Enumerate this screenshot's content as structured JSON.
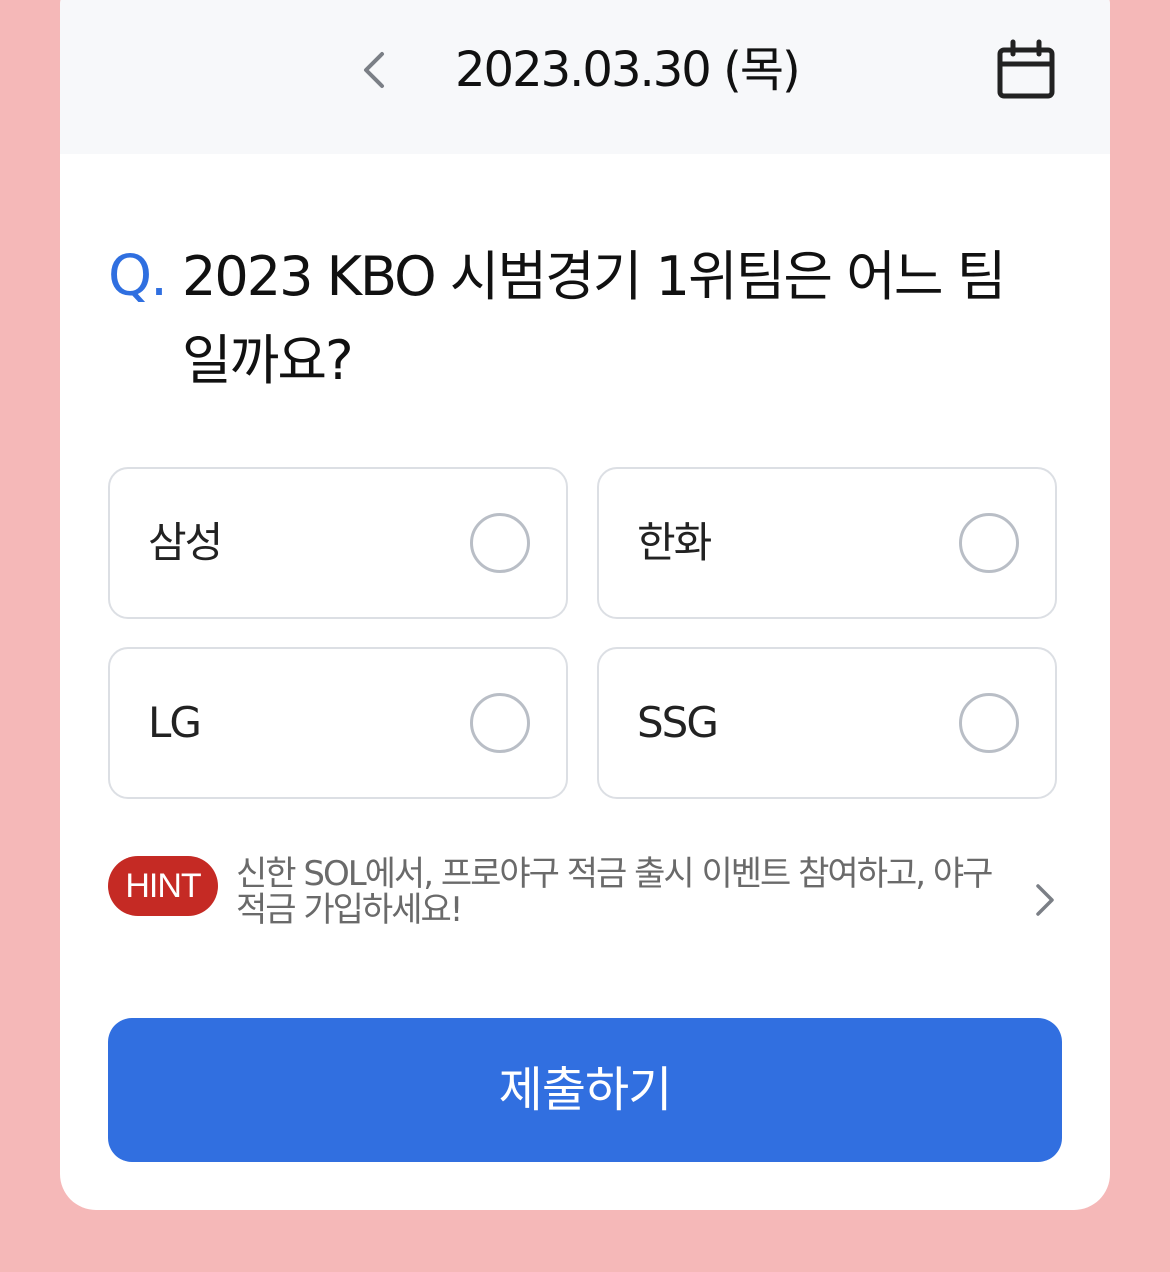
{
  "header": {
    "date": "2023.03.30 (목)",
    "prev_icon": "chevron-left-icon",
    "calendar_icon": "calendar-icon"
  },
  "question": {
    "prefix": "Q.",
    "text": "2023 KBO 시범경기 1위팀은 어느 팀 일까요?"
  },
  "options": [
    {
      "label": "삼성",
      "selected": false
    },
    {
      "label": "한화",
      "selected": false
    },
    {
      "label": "LG",
      "selected": false
    },
    {
      "label": "SSG",
      "selected": false
    }
  ],
  "hint": {
    "badge": "HINT",
    "text": "신한 SOL에서, 프로야구 적금 출시 이벤트 참여하고, 야구적금 가입하세요!",
    "chevron_icon": "chevron-right-icon"
  },
  "submit": {
    "label": "제출하기"
  },
  "colors": {
    "background": "#f5b8b8",
    "accent_blue": "#316fe0",
    "hint_red": "#c52a24",
    "header_bg": "#f7f8fa"
  }
}
